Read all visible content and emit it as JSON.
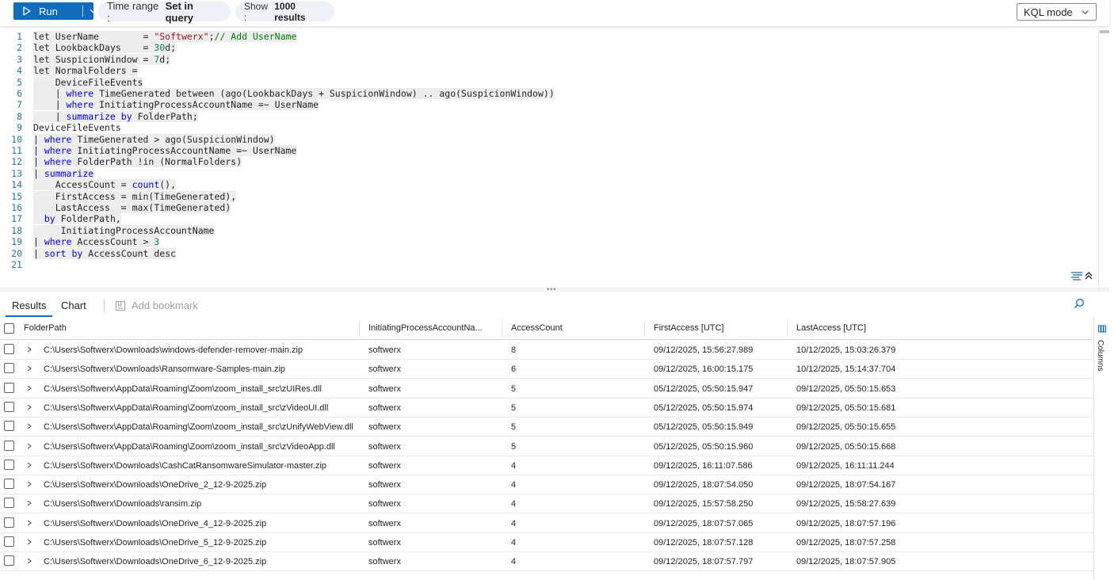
{
  "toolbar": {
    "run_label": "Run",
    "time_range_label": "Time range :",
    "time_range_value": "Set in query",
    "show_label": "Show :",
    "show_value": "1000 results",
    "mode_label": "KQL mode"
  },
  "editor": {
    "lines": [
      {
        "n": "1",
        "segs": [
          [
            "let UserName        = ",
            ""
          ],
          [
            "\"Softwerx\"",
            "str"
          ],
          [
            ";",
            ""
          ],
          [
            "// Add UserName",
            "cm"
          ]
        ]
      },
      {
        "n": "2",
        "segs": [
          [
            "let LookbackDays    = ",
            ""
          ],
          [
            "30",
            "num"
          ],
          [
            "d;",
            ""
          ]
        ]
      },
      {
        "n": "3",
        "segs": [
          [
            "let SuspicionWindow = ",
            ""
          ],
          [
            "7",
            "num"
          ],
          [
            "d;",
            ""
          ]
        ]
      },
      {
        "n": "4",
        "segs": [
          [
            "let NormalFolders =",
            ""
          ]
        ]
      },
      {
        "n": "5",
        "segs": [
          [
            "    DeviceFileEvents",
            ""
          ]
        ]
      },
      {
        "n": "6",
        "segs": [
          [
            "    | ",
            ""
          ],
          [
            "where",
            "kw"
          ],
          [
            " TimeGenerated between (ago(LookbackDays + SuspicionWindow) .. ago(SuspicionWindow))",
            ""
          ]
        ]
      },
      {
        "n": "7",
        "segs": [
          [
            "    | ",
            ""
          ],
          [
            "where",
            "kw"
          ],
          [
            " InitiatingProcessAccountName =~ UserName",
            ""
          ]
        ]
      },
      {
        "n": "8",
        "segs": [
          [
            "    | ",
            ""
          ],
          [
            "summarize",
            "kw"
          ],
          [
            " ",
            ""
          ],
          [
            "by",
            "kw"
          ],
          [
            " FolderPath;",
            ""
          ]
        ]
      },
      {
        "n": "9",
        "segs": [
          [
            "DeviceFileEvents",
            ""
          ]
        ]
      },
      {
        "n": "10",
        "segs": [
          [
            "| ",
            ""
          ],
          [
            "where",
            "kw"
          ],
          [
            " TimeGenerated > ago(SuspicionWindow)",
            ""
          ]
        ]
      },
      {
        "n": "11",
        "segs": [
          [
            "| ",
            ""
          ],
          [
            "where",
            "kw"
          ],
          [
            " InitiatingProcessAccountName =~ UserName",
            ""
          ]
        ]
      },
      {
        "n": "12",
        "segs": [
          [
            "| ",
            ""
          ],
          [
            "where",
            "kw"
          ],
          [
            " FolderPath !in (NormalFolders)",
            ""
          ]
        ]
      },
      {
        "n": "13",
        "segs": [
          [
            "| ",
            ""
          ],
          [
            "summarize",
            "kw"
          ]
        ]
      },
      {
        "n": "14",
        "segs": [
          [
            "    AccessCount = ",
            ""
          ],
          [
            "count",
            "kw"
          ],
          [
            "(),",
            ""
          ]
        ]
      },
      {
        "n": "15",
        "segs": [
          [
            "    FirstAccess = min(TimeGenerated),",
            ""
          ]
        ]
      },
      {
        "n": "16",
        "segs": [
          [
            "    LastAccess  = max(TimeGenerated)",
            ""
          ]
        ]
      },
      {
        "n": "17",
        "segs": [
          [
            "  ",
            ""
          ],
          [
            "by",
            "kw"
          ],
          [
            " FolderPath,",
            ""
          ]
        ]
      },
      {
        "n": "18",
        "segs": [
          [
            "     InitiatingProcessAccountName",
            ""
          ]
        ]
      },
      {
        "n": "19",
        "segs": [
          [
            "| ",
            ""
          ],
          [
            "where",
            "kw"
          ],
          [
            " AccessCount > ",
            ""
          ],
          [
            "3",
            "num"
          ]
        ]
      },
      {
        "n": "20",
        "segs": [
          [
            "| ",
            ""
          ],
          [
            "sort",
            "kw"
          ],
          [
            " ",
            ""
          ],
          [
            "by",
            "kw"
          ],
          [
            " AccessCount desc",
            ""
          ]
        ]
      },
      {
        "n": "21",
        "segs": []
      }
    ]
  },
  "results": {
    "tabs": [
      "Results",
      "Chart"
    ],
    "bookmark_label": "Add bookmark",
    "columns_panel_label": "Columns",
    "headers": [
      "FolderPath",
      "InitiatingProcessAccountNa...",
      "AccessCount",
      "FirstAccess [UTC]",
      "LastAccess [UTC]"
    ],
    "rows": [
      [
        "C:\\Users\\Softwerx\\Downloads\\windows-defender-remover-main.zip",
        "softwerx",
        "8",
        "09/12/2025, 15:56:27.989",
        "10/12/2025, 15:03:26.379"
      ],
      [
        "C:\\Users\\Softwerx\\Downloads\\Ransomware-Samples-main.zip",
        "softwerx",
        "6",
        "09/12/2025, 16:00:15.175",
        "10/12/2025, 15:14:37.704"
      ],
      [
        "C:\\Users\\Softwerx\\AppData\\Roaming\\Zoom\\zoom_install_src\\zUIRes.dll",
        "softwerx",
        "5",
        "05/12/2025, 05:50:15.947",
        "09/12/2025, 05:50:15.653"
      ],
      [
        "C:\\Users\\Softwerx\\AppData\\Roaming\\Zoom\\zoom_install_src\\zVideoUI.dll",
        "softwerx",
        "5",
        "05/12/2025, 05:50:15.974",
        "09/12/2025, 05:50:15.681"
      ],
      [
        "C:\\Users\\Softwerx\\AppData\\Roaming\\Zoom\\zoom_install_src\\zUnifyWebView.dll",
        "softwerx",
        "5",
        "05/12/2025, 05:50:15.949",
        "09/12/2025, 05:50:15.655"
      ],
      [
        "C:\\Users\\Softwerx\\AppData\\Roaming\\Zoom\\zoom_install_src\\zVideoApp.dll",
        "softwerx",
        "5",
        "05/12/2025, 05:50:15.960",
        "09/12/2025, 05:50:15.668"
      ],
      [
        "C:\\Users\\Softwerx\\Downloads\\CashCatRansomwareSimulator-master.zip",
        "softwerx",
        "4",
        "09/12/2025, 16:11:07.586",
        "09/12/2025, 16:11:11.244"
      ],
      [
        "C:\\Users\\Softwerx\\Downloads\\OneDrive_2_12-9-2025.zip",
        "softwerx",
        "4",
        "09/12/2025, 18:07:54.050",
        "09/12/2025, 18:07:54.167"
      ],
      [
        "C:\\Users\\Softwerx\\Downloads\\ransim.zip",
        "softwerx",
        "4",
        "09/12/2025, 15:57:58.250",
        "09/12/2025, 15:58:27.639"
      ],
      [
        "C:\\Users\\Softwerx\\Downloads\\OneDrive_4_12-9-2025.zip",
        "softwerx",
        "4",
        "09/12/2025, 18:07:57.065",
        "09/12/2025, 18:07:57.196"
      ],
      [
        "C:\\Users\\Softwerx\\Downloads\\OneDrive_5_12-9-2025.zip",
        "softwerx",
        "4",
        "09/12/2025, 18:07:57.128",
        "09/12/2025, 18:07:57.258"
      ],
      [
        "C:\\Users\\Softwerx\\Downloads\\OneDrive_6_12-9-2025.zip",
        "softwerx",
        "4",
        "09/12/2025, 18:07:57.797",
        "09/12/2025, 18:07:57.905"
      ]
    ]
  },
  "colors": {
    "accent": "#0f6cbd",
    "keyword": "#0000ff",
    "string": "#a31515",
    "comment": "#008000",
    "number": "#098658",
    "line_number": "#237893"
  }
}
